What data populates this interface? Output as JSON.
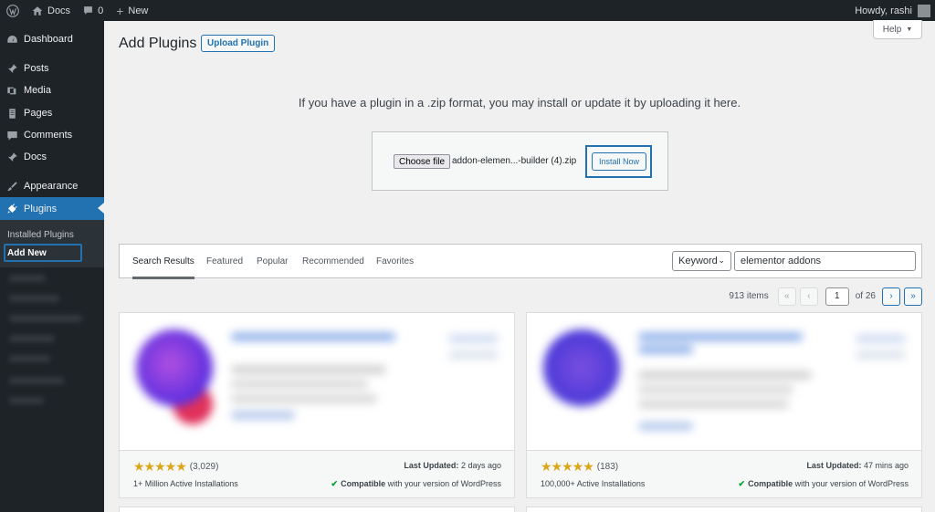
{
  "adminbar": {
    "site_name": "Docs",
    "comments_count": "0",
    "new_label": "New",
    "greeting": "Howdy, rashi"
  },
  "sidebar": {
    "items": [
      {
        "label": "Dashboard",
        "icon": "dashboard-icon"
      },
      {
        "label": "Posts",
        "icon": "pin-icon"
      },
      {
        "label": "Media",
        "icon": "media-icon"
      },
      {
        "label": "Pages",
        "icon": "page-icon"
      },
      {
        "label": "Comments",
        "icon": "comment-icon"
      },
      {
        "label": "Docs",
        "icon": "pin-icon"
      },
      {
        "label": "Appearance",
        "icon": "brush-icon"
      },
      {
        "label": "Plugins",
        "icon": "plugin-icon"
      }
    ],
    "submenu": [
      {
        "label": "Installed Plugins"
      },
      {
        "label": "Add New"
      }
    ]
  },
  "main": {
    "help_label": "Help",
    "title": "Add Plugins",
    "upload_plugin_label": "Upload Plugin",
    "upload_help": "If you have a plugin in a .zip format, you may install or update it by uploading it here.",
    "choose_file_label": "Choose file",
    "file_name": "addon-elemen...-builder (4).zip",
    "install_now_label": "Install Now"
  },
  "filter": {
    "tabs": [
      {
        "label": "Search Results",
        "active": true
      },
      {
        "label": "Featured"
      },
      {
        "label": "Popular"
      },
      {
        "label": "Recommended"
      },
      {
        "label": "Favorites"
      }
    ],
    "search_type": "Keyword",
    "search_value": "elementor addons"
  },
  "pagination": {
    "items_count": "913 items",
    "first": "«",
    "prev": "‹",
    "current_page": "1",
    "of_pages": "of 26",
    "next": "›",
    "last": "»"
  },
  "cards": [
    {
      "rating": 5,
      "rating_count": "(3,029)",
      "installs": "1+ Million Active Installations",
      "updated_label": "Last Updated:",
      "updated_value": "2 days ago",
      "compat_strong": "Compatible",
      "compat_rest": "with your version of WordPress"
    },
    {
      "rating": 5,
      "rating_count": "(183)",
      "installs": "100,000+ Active Installations",
      "updated_label": "Last Updated:",
      "updated_value": "47 mins ago",
      "compat_strong": "Compatible",
      "compat_rest": "with your version of WordPress"
    }
  ],
  "colors": {
    "accent": "#2271b1",
    "sidebar_bg": "#1d2327",
    "star": "#dba617",
    "check": "#00a32a"
  }
}
